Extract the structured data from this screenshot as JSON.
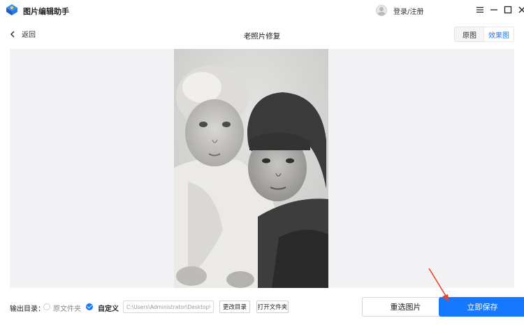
{
  "window": {
    "app_title": "图片编辑助手",
    "login_label": "登录/注册",
    "controls": {
      "menu_icon": "menu-icon",
      "minimize_icon": "minimize-icon",
      "maximize_icon": "maximize-icon",
      "close_icon": "close-icon"
    }
  },
  "header": {
    "back_label": "返回",
    "page_title": "老照片修复",
    "view_toggle": [
      {
        "label": "原图",
        "active": false
      },
      {
        "label": "效果图",
        "active": true
      }
    ]
  },
  "main": {
    "image_description_icon": "restored-photo-image"
  },
  "footer": {
    "output_label": "输出目录：",
    "radio_original": {
      "label": "原文件夹",
      "checked": false
    },
    "radio_custom": {
      "label": "自定义",
      "checked": true
    },
    "path_value": "C:\\Users\\Administrator\\Desktop\\图",
    "change_dir_label": "更改目录",
    "open_folder_label": "打开文件夹",
    "reselect_label": "重选图片",
    "save_label": "立即保存"
  },
  "colors": {
    "accent": "#1677ff",
    "annotation_arrow": "#e8452c",
    "canvas_bg": "#f3f3f5"
  }
}
